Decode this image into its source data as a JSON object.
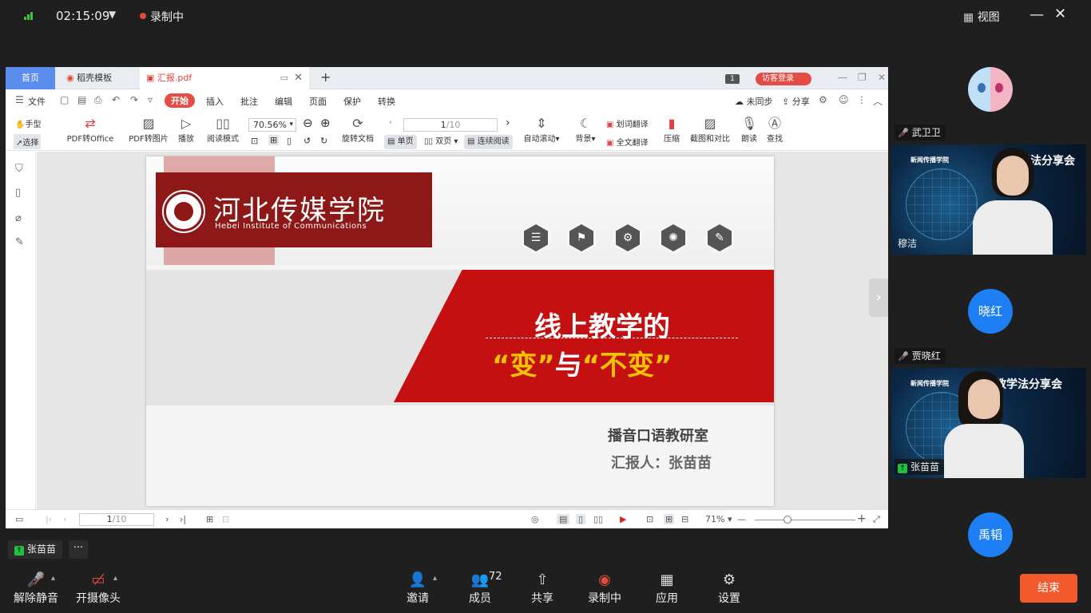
{
  "topbar": {
    "time": "02:15:09",
    "recording": "录制中",
    "view": "视图"
  },
  "pdf_app": {
    "tabs": {
      "home": "首页",
      "template": "稻壳模板",
      "file": "汇报.pdf"
    },
    "visitor_login": "访客登录",
    "badge": "1",
    "menu": [
      "文件",
      "开始",
      "插入",
      "批注",
      "编辑",
      "页面",
      "保护",
      "转换"
    ],
    "menu_active": "开始",
    "sync": "未同步",
    "share": "分享",
    "tools": {
      "hand": "手型",
      "select": "选择",
      "pdf_to_office": "PDF转Office",
      "pdf_to_image": "PDF转图片",
      "play": "播放",
      "read_mode": "阅读模式",
      "zoom": "70.56%",
      "rotate": "旋转文档",
      "page": "1",
      "page_total": "/10",
      "single": "单页",
      "double": "双页",
      "continuous": "连续阅读",
      "auto_scroll": "自动滚动",
      "background": "背景",
      "translate_word": "划词翻译",
      "translate_full": "全文翻译",
      "compress": "压缩",
      "screenshot_compare": "截图和对比",
      "read_aloud": "朗读",
      "find": "查找"
    },
    "status": {
      "page": "1",
      "page_total": "/10",
      "zoom": "71%"
    }
  },
  "slide": {
    "logo_cn": "河北传媒学院",
    "logo_en": "Hebei Institute of Communications",
    "title_line1": "线上教学的",
    "title_q1": "“变”",
    "title_mid": "与",
    "title_q2": "“不变”",
    "department": "播音口语教研室",
    "reporter": "汇报人：张苗苗"
  },
  "participants": [
    {
      "name": "武卫卫",
      "type": "avatar-image",
      "muted": true
    },
    {
      "name": "穆洁",
      "type": "video",
      "banner": "学法分享会",
      "banner_small": "新闻传播学院"
    },
    {
      "name": "贾晓红",
      "type": "avatar-text",
      "avatar_text": "晓红",
      "muted": true,
      "color": "#1e7ff5"
    },
    {
      "name": "张苗苗",
      "type": "video",
      "banner": "上教学法分享会",
      "banner_small": "新闻传播学院",
      "speaking": true
    },
    {
      "name": "禹韬",
      "type": "avatar-text",
      "avatar_text": "禹韬",
      "color": "#1e7ff5"
    }
  ],
  "presenter_chip": "张苗苗",
  "bottombar": {
    "unmute": "解除静音",
    "camera": "开摄像头",
    "invite": "邀请",
    "members": "成员",
    "member_count": "72",
    "share": "共享",
    "record": "录制中",
    "apps": "应用",
    "settings": "设置",
    "end": "结束"
  }
}
